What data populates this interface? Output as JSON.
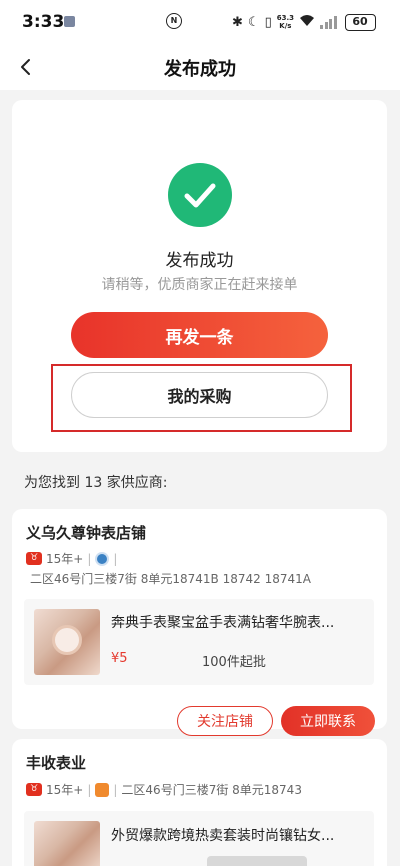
{
  "status_bar": {
    "time": "3:33",
    "nfc": "N",
    "speed_top": "63.3",
    "speed_bottom": "K/s",
    "battery": "60"
  },
  "nav": {
    "title": "发布成功"
  },
  "success": {
    "title": "发布成功",
    "subtitle": "请稍等，优质商家正在赶来接单",
    "repost_label": "再发一条",
    "my_purchases_label": "我的采购",
    "check_color": "#20b877"
  },
  "found_text": "为您找到 13 家供应商:",
  "suppliers": [
    {
      "name": "义乌久尊钟表店铺",
      "years": "15年+",
      "address": "二区46号门三楼7街 8单元18741B 18742 18741A",
      "product": {
        "title": "奔典手表聚宝盆手表满钻奢华腕表...",
        "price": "¥5",
        "moq": "100件起批"
      },
      "follow_label": "关注店铺",
      "contact_label": "立即联系"
    },
    {
      "name": "丰收表业",
      "years": "15年+",
      "address": "二区46号门三楼7街 8单元18743",
      "product": {
        "title": "外贸爆款跨境热卖套装时尚镶钻女..."
      }
    }
  ],
  "accent_color": "#e8332a"
}
